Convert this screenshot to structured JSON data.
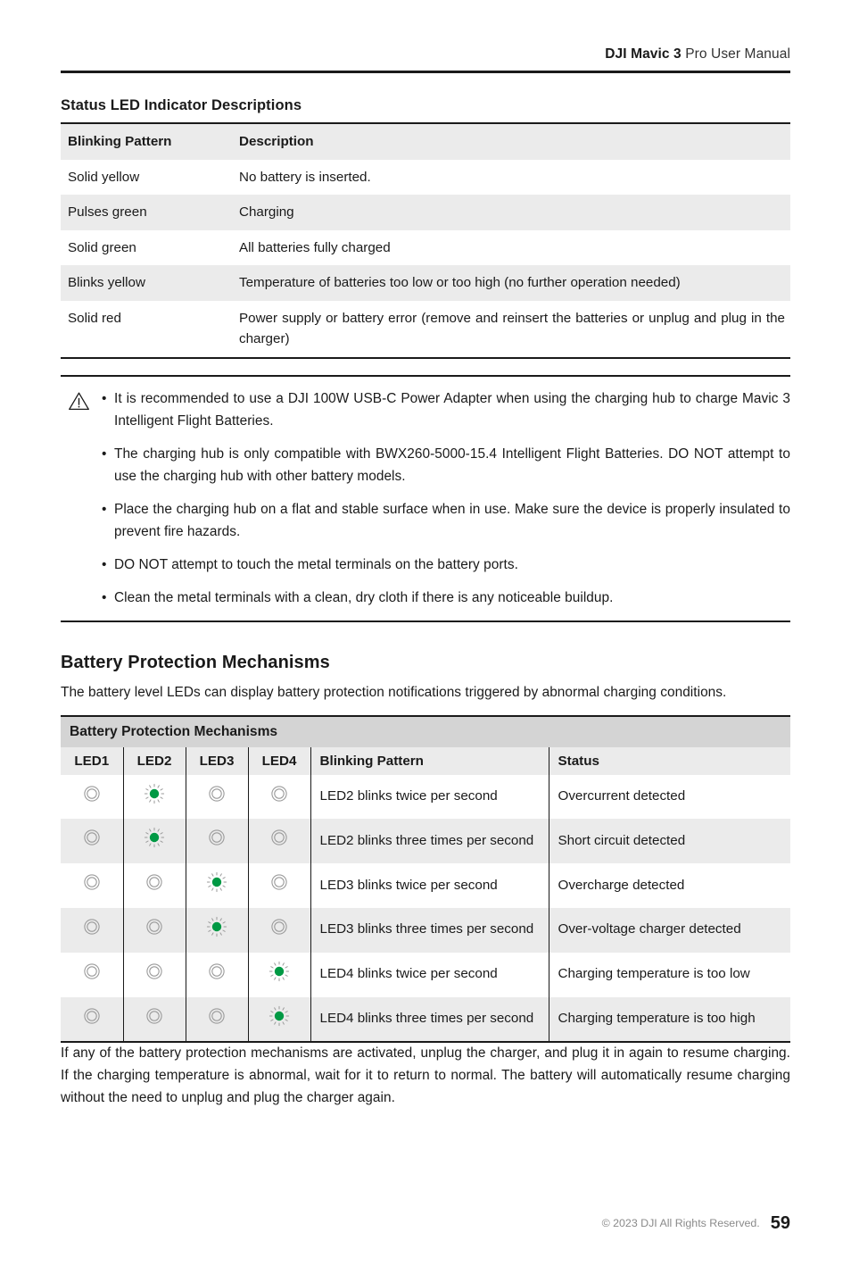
{
  "header": {
    "brand": "DJI Mavic 3",
    "rest": " Pro User Manual"
  },
  "status_led": {
    "heading": "Status LED Indicator Descriptions",
    "columns": [
      "Blinking Pattern",
      "Description"
    ],
    "rows": [
      {
        "pattern": "Solid yellow",
        "description": "No battery is inserted."
      },
      {
        "pattern": "Pulses green",
        "description": "Charging"
      },
      {
        "pattern": "Solid green",
        "description": "All batteries fully charged"
      },
      {
        "pattern": "Blinks yellow",
        "description": "Temperature of batteries too low or too high (no further operation needed)"
      },
      {
        "pattern": "Solid red",
        "description": "Power supply or battery error (remove and reinsert the batteries or unplug and plug in the charger)"
      }
    ]
  },
  "notes": {
    "icon": "warning-triangle-icon",
    "bullet": "•",
    "items": [
      "It is recommended to use a DJI 100W USB-C Power Adapter when using the charging hub to charge Mavic 3 Intelligent Flight Batteries.",
      "The charging hub is only compatible with BWX260-5000-15.4 Intelligent Flight Batteries. DO NOT attempt to use the charging hub with other battery models.",
      "Place the charging hub on a flat and stable surface when in use. Make sure the device is properly insulated to prevent fire hazards.",
      "DO NOT attempt to touch the metal terminals on the battery ports.",
      "Clean the metal terminals with a clean, dry cloth if there is any noticeable buildup."
    ]
  },
  "protection": {
    "heading": "Battery Protection Mechanisms",
    "intro": "The battery level LEDs can display battery protection notifications triggered by abnormal charging conditions.",
    "table_title": "Battery Protection Mechanisms",
    "columns": [
      "LED1",
      "LED2",
      "LED3",
      "LED4",
      "Blinking Pattern",
      "Status"
    ],
    "led_on_color": "#009944",
    "led_off_color": "#9a9a9a",
    "rows": [
      {
        "leds": [
          "off",
          "on",
          "off",
          "off"
        ],
        "pattern": "LED2 blinks twice per second",
        "status": "Overcurrent detected"
      },
      {
        "leds": [
          "off",
          "on",
          "off",
          "off"
        ],
        "pattern": "LED2 blinks three times per second",
        "status": "Short circuit detected"
      },
      {
        "leds": [
          "off",
          "off",
          "on",
          "off"
        ],
        "pattern": "LED3 blinks twice per second",
        "status": "Overcharge detected"
      },
      {
        "leds": [
          "off",
          "off",
          "on",
          "off"
        ],
        "pattern": "LED3 blinks three times per second",
        "status": "Over-voltage charger detected"
      },
      {
        "leds": [
          "off",
          "off",
          "off",
          "on"
        ],
        "pattern": "LED4 blinks twice per second",
        "status": "Charging temperature is too low"
      },
      {
        "leds": [
          "off",
          "off",
          "off",
          "on"
        ],
        "pattern": "LED4 blinks three times per second",
        "status": "Charging temperature is too high"
      }
    ]
  },
  "closing_paragraph": "If any of the battery protection mechanisms are activated, unplug the charger, and plug it in again to resume charging. If the charging temperature is abnormal, wait for it to return to normal. The battery will automatically resume charging without the need to unplug and plug the charger again.",
  "footer": {
    "copyright": "© 2023 DJI All Rights Reserved.",
    "page_number": "59"
  }
}
